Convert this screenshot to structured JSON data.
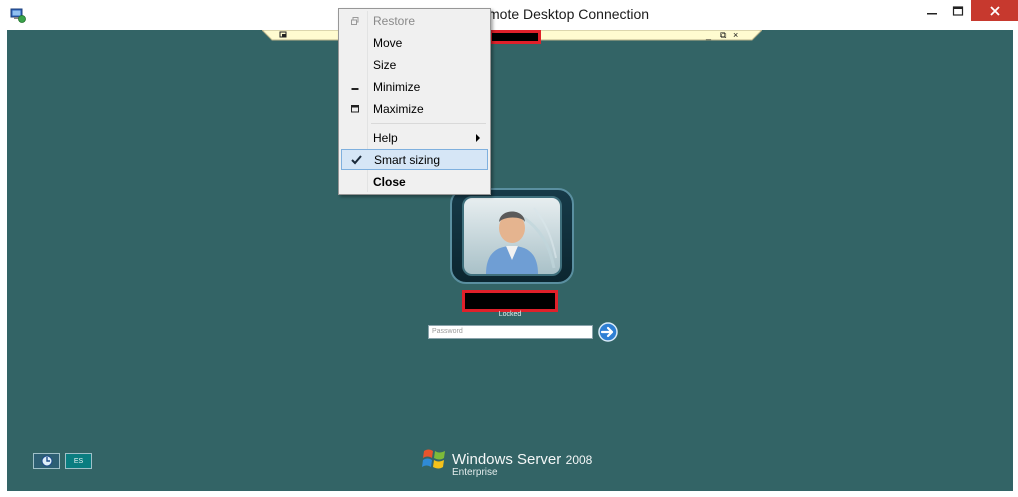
{
  "window": {
    "title": "mote Desktop Connection",
    "title_hint": "Remote Desktop Connection"
  },
  "connection_bar": {
    "pin_icon": "pin-icon",
    "controls": [
      "_",
      "⧉",
      "×"
    ]
  },
  "context_menu": {
    "items": [
      {
        "label": "Restore",
        "state": "disabled",
        "icon": "restore-icon"
      },
      {
        "label": "Move",
        "state": "normal"
      },
      {
        "label": "Size",
        "state": "normal"
      },
      {
        "label": "Minimize",
        "state": "normal",
        "icon": "minimize-icon"
      },
      {
        "label": "Maximize",
        "state": "normal",
        "icon": "maximize-icon"
      },
      {
        "label": "Help",
        "state": "normal",
        "submenu": true
      },
      {
        "label": "Smart sizing",
        "state": "checked-selected",
        "icon": "checkmark-icon"
      },
      {
        "label": "Close",
        "state": "bold"
      }
    ]
  },
  "login": {
    "status": "Locked",
    "password_placeholder": "Password"
  },
  "bottom_buttons": {
    "lang": "ES"
  },
  "branding": {
    "product": "Windows Server",
    "version": "2008",
    "edition": "Enterprise"
  },
  "colors": {
    "desktop_bg": "#336466",
    "close_button": "#c7392e",
    "redaction_border": "#e0202a",
    "connection_bar": "#fffbd0"
  }
}
